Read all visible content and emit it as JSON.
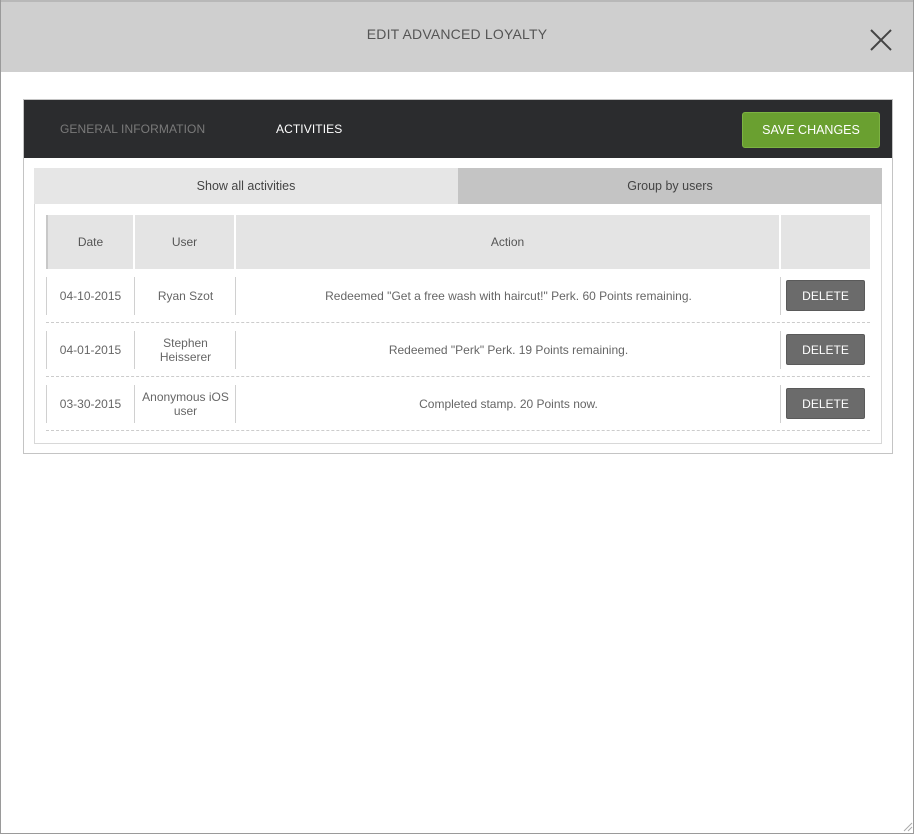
{
  "modal": {
    "title": "EDIT ADVANCED LOYALTY",
    "close_icon": "close-icon"
  },
  "panel": {
    "tabs": [
      {
        "label": "GENERAL INFORMATION",
        "active": false
      },
      {
        "label": "ACTIVITIES",
        "active": true
      }
    ],
    "save_label": "SAVE CHANGES"
  },
  "subtabs": [
    {
      "label": "Show all activities",
      "active": true
    },
    {
      "label": "Group by users",
      "active": false
    }
  ],
  "table": {
    "headers": [
      "Date",
      "User",
      "Action",
      ""
    ],
    "rows": [
      {
        "date": "04-10-2015",
        "user": "Ryan Szot",
        "action": "Redeemed \"Get a free wash with haircut!\" Perk. 60 Points remaining.",
        "button": "DELETE"
      },
      {
        "date": "04-01-2015",
        "user": "Stephen Heisserer",
        "action": "Redeemed \"Perk\" Perk. 19 Points remaining.",
        "button": "DELETE"
      },
      {
        "date": "03-30-2015",
        "user": "Anonymous iOS user",
        "action": "Completed stamp. 20 Points now.",
        "button": "DELETE"
      }
    ]
  },
  "colors": {
    "header_bg": "#cfcfcf",
    "panel_bar_bg": "#2b2c2e",
    "save_button": "#6aa030",
    "delete_button": "#6b6b6b"
  }
}
